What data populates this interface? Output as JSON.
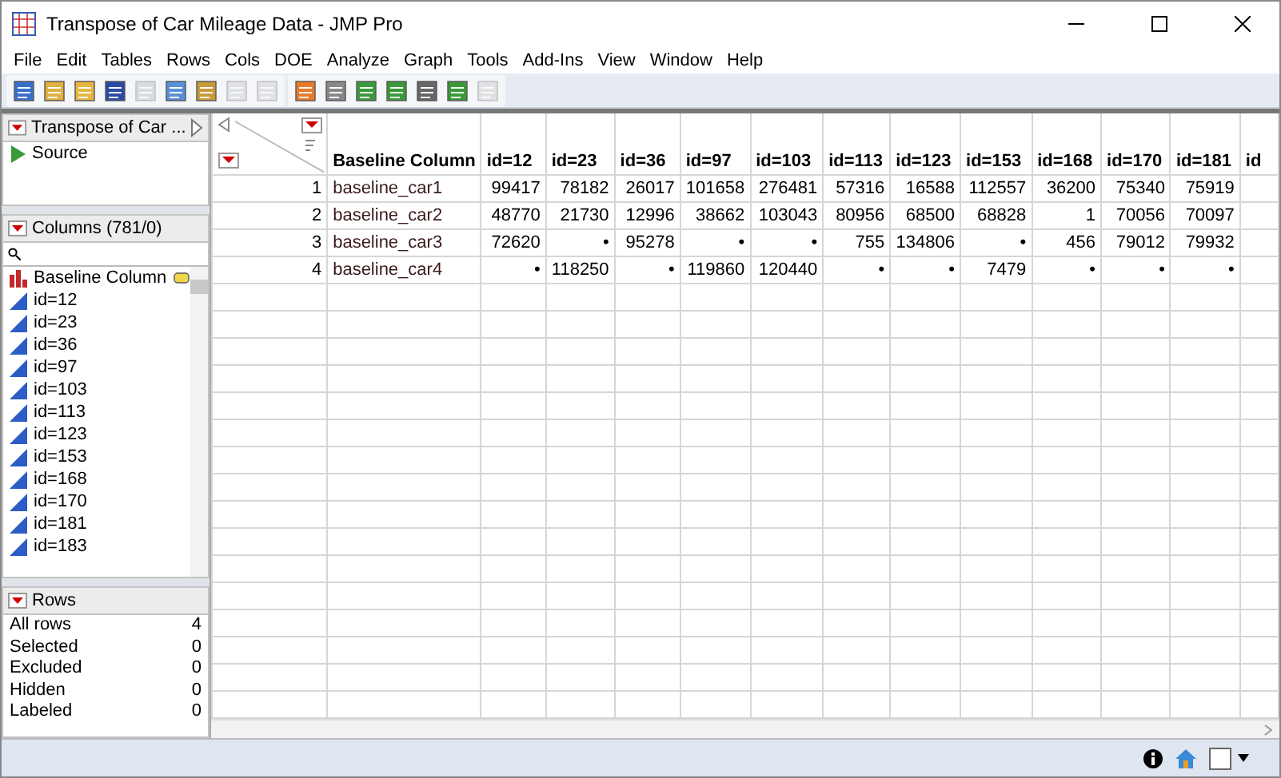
{
  "window": {
    "title": "Transpose of Car Mileage Data - JMP Pro"
  },
  "menu": [
    "File",
    "Edit",
    "Tables",
    "Rows",
    "Cols",
    "DOE",
    "Analyze",
    "Graph",
    "Tools",
    "Add-Ins",
    "View",
    "Window",
    "Help"
  ],
  "table_panel": {
    "title": "Transpose of Car ...",
    "items": [
      {
        "label": "Source"
      }
    ]
  },
  "columns_panel": {
    "title": "Columns (781/0)",
    "items": [
      {
        "label": "Baseline Column",
        "kind": "nominal"
      },
      {
        "label": "id=12",
        "kind": "continuous"
      },
      {
        "label": "id=23",
        "kind": "continuous"
      },
      {
        "label": "id=36",
        "kind": "continuous"
      },
      {
        "label": "id=97",
        "kind": "continuous"
      },
      {
        "label": "id=103",
        "kind": "continuous"
      },
      {
        "label": "id=113",
        "kind": "continuous"
      },
      {
        "label": "id=123",
        "kind": "continuous"
      },
      {
        "label": "id=153",
        "kind": "continuous"
      },
      {
        "label": "id=168",
        "kind": "continuous"
      },
      {
        "label": "id=170",
        "kind": "continuous"
      },
      {
        "label": "id=181",
        "kind": "continuous"
      },
      {
        "label": "id=183",
        "kind": "continuous"
      }
    ]
  },
  "rows_panel": {
    "title": "Rows",
    "items": [
      {
        "label": "All rows",
        "value": "4"
      },
      {
        "label": "Selected",
        "value": "0"
      },
      {
        "label": "Excluded",
        "value": "0"
      },
      {
        "label": "Hidden",
        "value": "0"
      },
      {
        "label": "Labeled",
        "value": "0"
      }
    ]
  },
  "table": {
    "columns": [
      "Baseline Column",
      "id=12",
      "id=23",
      "id=36",
      "id=97",
      "id=103",
      "id=113",
      "id=123",
      "id=153",
      "id=168",
      "id=170",
      "id=181",
      "id"
    ],
    "rows": [
      {
        "number": "1",
        "cells": [
          "baseline_car1",
          "99417",
          "78182",
          "26017",
          "101658",
          "276481",
          "57316",
          "16588",
          "112557",
          "36200",
          "75340",
          "75919",
          null
        ]
      },
      {
        "number": "2",
        "cells": [
          "baseline_car2",
          "48770",
          "21730",
          "12996",
          "38662",
          "103043",
          "80956",
          "68500",
          "68828",
          "1",
          "70056",
          "70097",
          null
        ]
      },
      {
        "number": "3",
        "cells": [
          "baseline_car3",
          "72620",
          "•",
          "95278",
          "•",
          "•",
          "755",
          "134806",
          "•",
          "456",
          "79012",
          "79932",
          null
        ]
      },
      {
        "number": "4",
        "cells": [
          "baseline_car4",
          "•",
          "118250",
          "•",
          "119860",
          "120440",
          "•",
          "•",
          "7479",
          "•",
          "•",
          "•",
          null
        ]
      }
    ]
  }
}
